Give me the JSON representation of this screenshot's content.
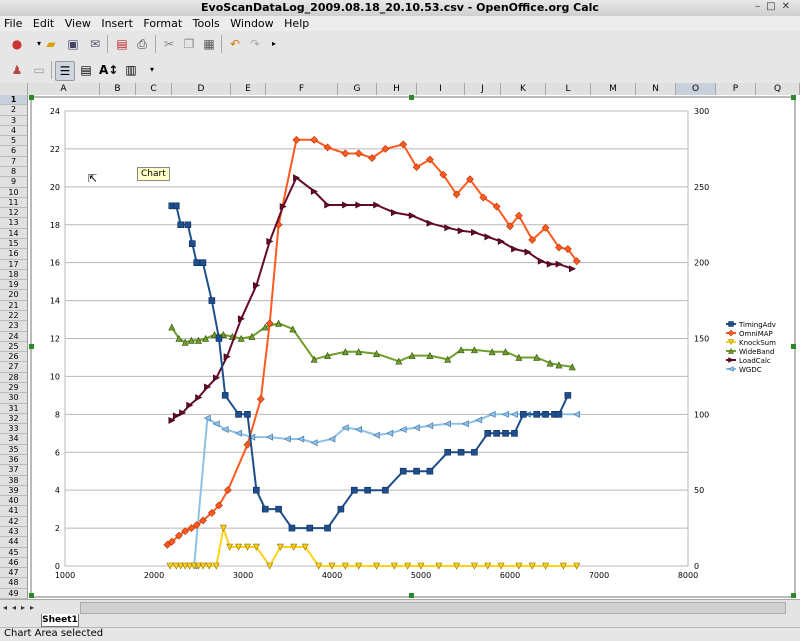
{
  "window": {
    "title": "EvoScanDataLog_2009.08.18_20.10.53.csv - OpenOffice.org Calc"
  },
  "menu": [
    "File",
    "Edit",
    "View",
    "Insert",
    "Format",
    "Tools",
    "Window",
    "Help"
  ],
  "columns": [
    "A",
    "B",
    "C",
    "D",
    "E",
    "F",
    "G",
    "H",
    "I",
    "J",
    "K",
    "L",
    "M",
    "N",
    "O",
    "P",
    "Q"
  ],
  "rows": [
    "1",
    "2",
    "3",
    "4",
    "5",
    "6",
    "7",
    "8",
    "9",
    "10",
    "11",
    "12",
    "13",
    "14",
    "15",
    "16",
    "17",
    "18",
    "19",
    "20",
    "21",
    "22",
    "23",
    "24",
    "25",
    "26",
    "27",
    "28",
    "29",
    "30",
    "31",
    "32",
    "33",
    "34",
    "35",
    "36",
    "37",
    "38",
    "39",
    "40",
    "41",
    "42",
    "43",
    "44",
    "45",
    "46",
    "47",
    "48",
    "49"
  ],
  "sheet_tab": "Sheet1",
  "status_text": "Chart Area selected",
  "tooltip": "Chart",
  "colors": {
    "TimingAdv": "#1f4e8c",
    "OmniMAP": "#ff5a1f",
    "KnockSum": "#ffd21a",
    "WideBand": "#6f9e2a",
    "LoadCalc": "#650a2a",
    "WGDC": "#8ec1e6"
  },
  "chart_data": {
    "type": "line",
    "x_range": [
      1000,
      8000
    ],
    "x_ticks": [
      1000,
      2000,
      3000,
      4000,
      5000,
      6000,
      7000,
      8000
    ],
    "y_left_range": [
      0,
      24
    ],
    "y_left_ticks": [
      0,
      2,
      4,
      6,
      8,
      10,
      12,
      14,
      16,
      18,
      20,
      22,
      24
    ],
    "y_right_range": [
      0,
      300
    ],
    "y_right_ticks": [
      0,
      50,
      100,
      150,
      200,
      250,
      300
    ],
    "grid": "horizontal",
    "legend_position": "right",
    "series": [
      {
        "name": "TimingAdv",
        "axis": "left",
        "marker": "square",
        "x": [
          2200,
          2250,
          2300,
          2380,
          2430,
          2480,
          2550,
          2650,
          2730,
          2800,
          2950,
          3050,
          3150,
          3250,
          3400,
          3550,
          3750,
          3950,
          4100,
          4250,
          4400,
          4600,
          4800,
          4950,
          5100,
          5300,
          5450,
          5600,
          5750,
          5850,
          5950,
          6050,
          6150,
          6300,
          6400,
          6500,
          6550,
          6650
        ],
        "y": [
          19,
          19,
          18,
          18,
          17,
          16,
          16,
          14,
          12,
          9,
          8,
          8,
          4,
          3,
          3,
          2,
          2,
          2,
          3,
          4,
          4,
          4,
          5,
          5,
          5,
          6,
          6,
          6,
          7,
          7,
          7,
          7,
          8,
          8,
          8,
          8,
          8,
          9
        ]
      },
      {
        "name": "OmniMAP",
        "axis": "right",
        "marker": "diamond",
        "x": [
          2150,
          2200,
          2280,
          2350,
          2420,
          2480,
          2550,
          2650,
          2730,
          2830,
          3050,
          3200,
          3300,
          3400,
          3600,
          3800,
          3950,
          4150,
          4300,
          4450,
          4600,
          4800,
          4950,
          5100,
          5250,
          5400,
          5550,
          5700,
          5850,
          6000,
          6100,
          6250,
          6400,
          6550,
          6650,
          6750
        ],
        "y": [
          14,
          16,
          20,
          23,
          25,
          27,
          30,
          35,
          40,
          50,
          80,
          110,
          160,
          225,
          281,
          281,
          276,
          272,
          272,
          269,
          275,
          278,
          263,
          268,
          258,
          245,
          255,
          243,
          237,
          224,
          231,
          215,
          223,
          210,
          209,
          201
        ]
      },
      {
        "name": "KnockSum",
        "axis": "left",
        "marker": "triangle-down",
        "x": [
          2180,
          2250,
          2300,
          2350,
          2400,
          2450,
          2500,
          2550,
          2620,
          2700,
          2780,
          2850,
          2950,
          3050,
          3150,
          3300,
          3420,
          3570,
          3700,
          3850,
          4000,
          4150,
          4300,
          4500,
          4700,
          4850,
          5000,
          5200,
          5400,
          5600,
          5750,
          5900,
          6100,
          6250,
          6400,
          6600,
          6750
        ],
        "y": [
          0,
          0,
          0,
          0,
          0,
          0,
          0,
          0,
          0,
          0,
          2,
          1,
          1,
          1,
          1,
          0,
          1,
          1,
          1,
          0,
          0,
          0,
          0,
          0,
          0,
          0,
          0,
          0,
          0,
          0,
          0,
          0,
          0,
          0,
          0,
          0,
          0
        ]
      },
      {
        "name": "WideBand",
        "axis": "left",
        "marker": "triangle-up",
        "x": [
          2200,
          2280,
          2350,
          2420,
          2500,
          2580,
          2680,
          2780,
          2880,
          2980,
          3100,
          3250,
          3400,
          3560,
          3800,
          3950,
          4150,
          4300,
          4500,
          4750,
          4900,
          5100,
          5300,
          5450,
          5600,
          5800,
          5950,
          6100,
          6300,
          6450,
          6550,
          6700
        ],
        "y": [
          12.6,
          12.0,
          11.8,
          11.9,
          11.9,
          12.0,
          12.2,
          12.2,
          12.1,
          12.0,
          12.1,
          12.6,
          12.8,
          12.5,
          10.9,
          11.1,
          11.3,
          11.3,
          11.2,
          10.8,
          11.1,
          11.1,
          10.9,
          11.4,
          11.4,
          11.3,
          11.3,
          11.0,
          11.0,
          10.7,
          10.6,
          10.5
        ]
      },
      {
        "name": "LoadCalc",
        "axis": "right",
        "marker": "triangle-right",
        "x": [
          2200,
          2250,
          2320,
          2400,
          2500,
          2600,
          2700,
          2820,
          2980,
          3150,
          3300,
          3450,
          3600,
          3800,
          3950,
          4150,
          4300,
          4500,
          4700,
          4900,
          5100,
          5300,
          5450,
          5600,
          5750,
          5900,
          6050,
          6200,
          6350,
          6450,
          6550,
          6700
        ],
        "y": [
          96,
          99,
          101,
          106,
          111,
          118,
          124,
          138,
          163,
          185,
          214,
          237,
          256,
          247,
          238,
          238,
          238,
          238,
          233,
          231,
          226,
          223,
          221,
          220,
          217,
          214,
          209,
          207,
          201,
          199,
          199,
          196
        ]
      },
      {
        "name": "WGDC",
        "axis": "left",
        "marker": "triangle-left",
        "x": [
          2450,
          2600,
          2700,
          2800,
          2950,
          3100,
          3300,
          3500,
          3650,
          3800,
          4000,
          4150,
          4300,
          4500,
          4650,
          4800,
          4950,
          5100,
          5300,
          5500,
          5650,
          5800,
          5950,
          6050,
          6200,
          6350,
          6500,
          6750
        ],
        "y": [
          0,
          7.8,
          7.5,
          7.2,
          7.0,
          6.8,
          6.8,
          6.7,
          6.7,
          6.5,
          6.7,
          7.3,
          7.2,
          6.9,
          7.0,
          7.2,
          7.3,
          7.4,
          7.5,
          7.5,
          7.7,
          8.0,
          8.0,
          8.0,
          8.0,
          8.0,
          8.0,
          8.0
        ]
      }
    ]
  }
}
